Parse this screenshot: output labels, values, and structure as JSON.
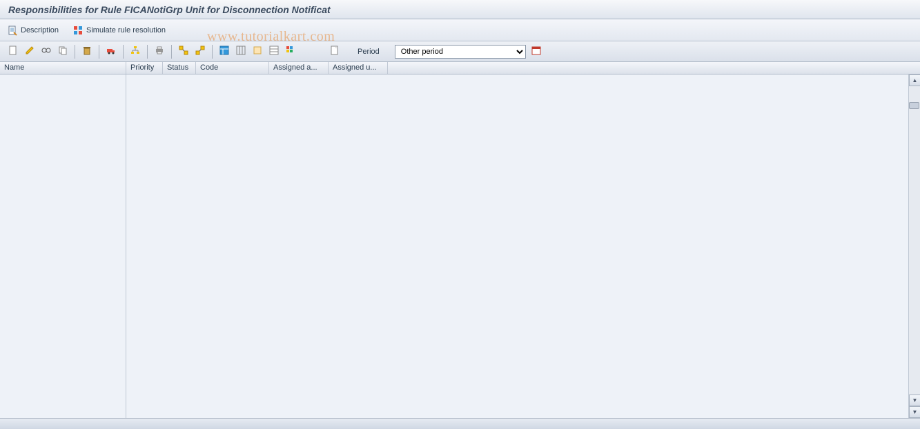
{
  "title": "Responsibilities for Rule FICANotiGrp Unit for Disconnection Notificat",
  "top_toolbar": {
    "description_label": "Description",
    "simulate_label": "Simulate rule resolution"
  },
  "toolbar_icons": {
    "create": "create-icon",
    "change": "change-icon",
    "display": "display-icon",
    "copy": "copy-icon",
    "delete": "delete-icon",
    "transport": "transport-icon",
    "where_used": "where-used-icon",
    "print": "print-icon",
    "expand": "expand-icon",
    "collapse": "collapse-icon",
    "layout": "layout-icon",
    "select_all": "select-all-icon",
    "deselect": "deselect-icon",
    "sort": "sort-icon",
    "filter": "filter-icon",
    "more": "more-icon",
    "page": "page-icon",
    "date_pick": "date-icon"
  },
  "period": {
    "label": "Period",
    "selected": "Other period"
  },
  "columns": {
    "name": "Name",
    "priority": "Priority",
    "status": "Status",
    "code": "Code",
    "assigned_a": "Assigned a...",
    "assigned_u": "Assigned u..."
  },
  "grid_rows": [],
  "watermark": "www.tutorialkart.com"
}
